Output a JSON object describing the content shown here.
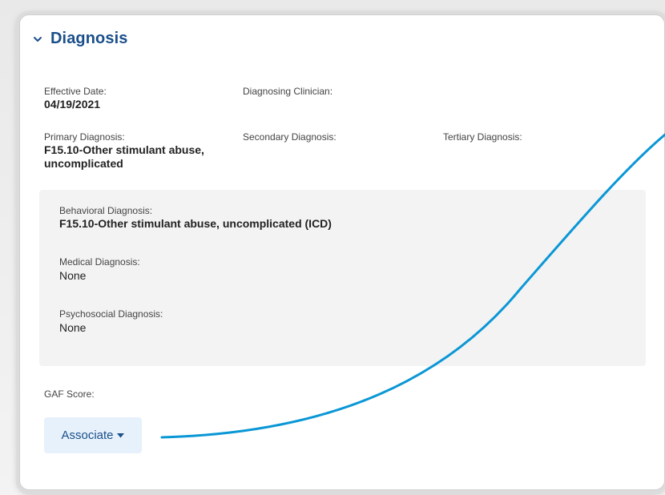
{
  "section": {
    "title": "Diagnosis",
    "collapse_icon": "chevron-down-icon"
  },
  "fields": {
    "effective_date_label": "Effective Date:",
    "effective_date_value": "04/19/2021",
    "diagnosing_clinician_label": "Diagnosing Clinician:",
    "primary_diagnosis_label": "Primary Diagnosis:",
    "primary_diagnosis_value_line1": "F15.10-Other stimulant abuse,",
    "primary_diagnosis_value_line2": "uncomplicated",
    "secondary_diagnosis_label": "Secondary Diagnosis:",
    "tertiary_diagnosis_label": "Tertiary Diagnosis:"
  },
  "diagnosis_panel": {
    "behavioral_label": "Behavioral Diagnosis:",
    "behavioral_value": "F15.10-Other stimulant abuse, uncomplicated (ICD)",
    "medical_label": "Medical Diagnosis:",
    "medical_value": "None",
    "psychosocial_label": "Psychosocial Diagnosis:",
    "psychosocial_value": "None"
  },
  "gaf": {
    "label": "GAF Score:"
  },
  "associate_button": {
    "label": "Associate",
    "icon": "caret-down-icon"
  },
  "colors": {
    "title_blue": "#1a4f8a",
    "annotation_line": "#0a97d6",
    "button_bg": "#e6f1fb",
    "panel_bg": "#f3f3f3"
  }
}
